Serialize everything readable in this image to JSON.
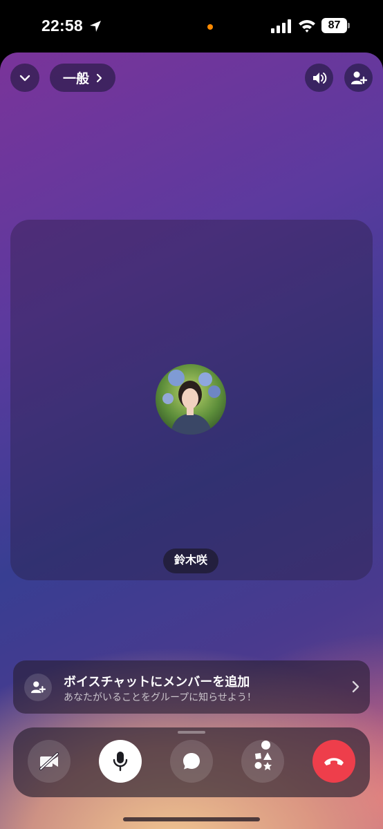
{
  "status_bar": {
    "time": "22:58",
    "battery": "87",
    "icons": [
      "location-arrow-icon",
      "signal-bars-icon",
      "wifi-icon",
      "battery-icon"
    ],
    "privacy_dot_color": "#ff8a00"
  },
  "header": {
    "channel_label": "一般",
    "icons": [
      "chevron-down-icon",
      "chevron-right-icon",
      "speaker-icon",
      "add-user-icon"
    ]
  },
  "participant": {
    "name": "鈴木咲"
  },
  "invite": {
    "title": "ボイスチャットにメンバーを追加",
    "subtitle": "あなたがいることをグループに知らせよう！"
  },
  "controls": {
    "icons": [
      "camera-off-icon",
      "microphone-icon",
      "chat-bubble-icon",
      "activities-icon",
      "end-call-icon"
    ],
    "end_call_color": "#ee3e4b"
  }
}
